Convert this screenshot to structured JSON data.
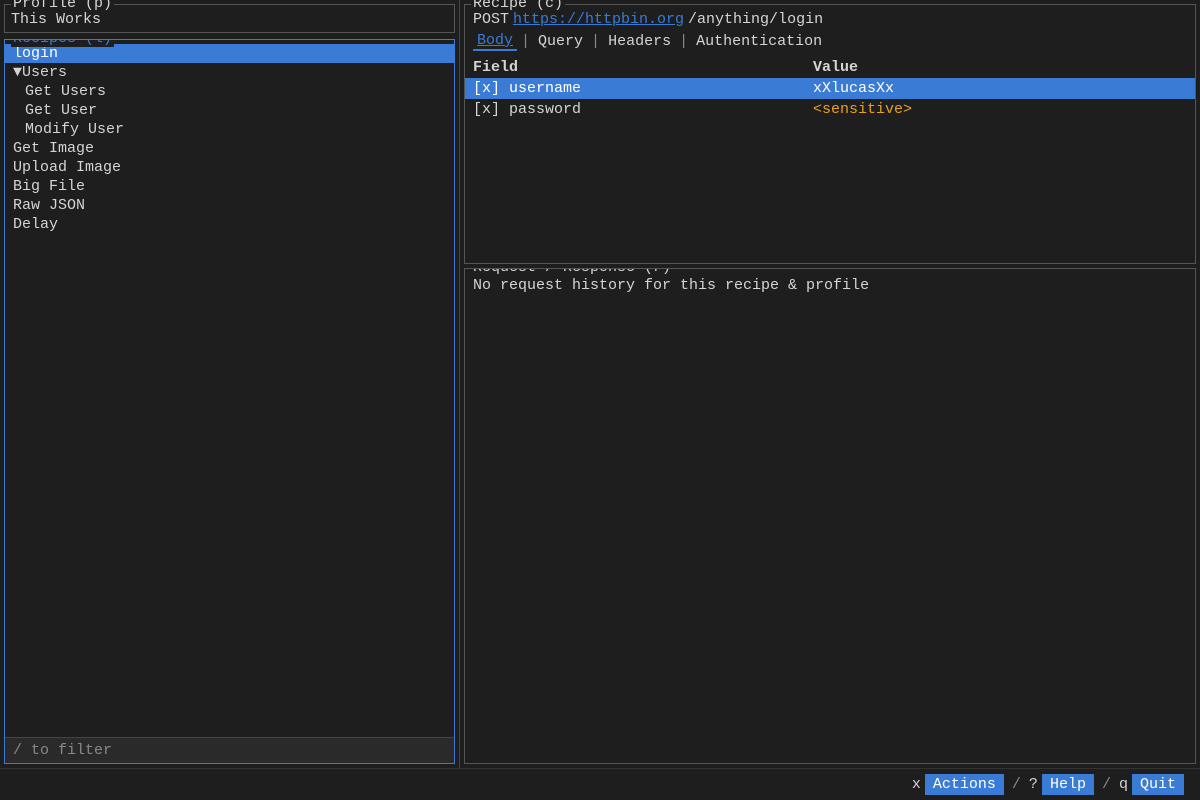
{
  "profile": {
    "section_title": "Profile (p)",
    "name": "This Works"
  },
  "recipes": {
    "section_title": "Recipes (l)",
    "items": [
      {
        "id": "login",
        "label": "login",
        "indent": 0,
        "selected": true
      },
      {
        "id": "users",
        "label": "▼Users",
        "indent": 0,
        "selected": false
      },
      {
        "id": "get-users",
        "label": "Get Users",
        "indent": 1,
        "selected": false
      },
      {
        "id": "get-user",
        "label": "Get User",
        "indent": 1,
        "selected": false
      },
      {
        "id": "modify-user",
        "label": "Modify User",
        "indent": 1,
        "selected": false
      },
      {
        "id": "get-image",
        "label": "Get Image",
        "indent": 0,
        "selected": false
      },
      {
        "id": "upload-image",
        "label": "Upload Image",
        "indent": 0,
        "selected": false
      },
      {
        "id": "big-file",
        "label": "Big File",
        "indent": 0,
        "selected": false
      },
      {
        "id": "raw-json",
        "label": "Raw JSON",
        "indent": 0,
        "selected": false
      },
      {
        "id": "delay",
        "label": "Delay",
        "indent": 0,
        "selected": false
      }
    ],
    "filter_placeholder": "/ to filter"
  },
  "recipe_detail": {
    "section_title": "Recipe (c)",
    "method": "POST",
    "url_base": "https://httpbin.org",
    "url_path": "/anything/login",
    "tabs": [
      {
        "id": "body",
        "label": "Body",
        "active": true
      },
      {
        "id": "query",
        "label": "Query",
        "active": false
      },
      {
        "id": "headers",
        "label": "Headers",
        "active": false
      },
      {
        "id": "authentication",
        "label": "Authentication",
        "active": false
      }
    ],
    "table": {
      "headers": {
        "field": "Field",
        "value": "Value"
      },
      "rows": [
        {
          "enabled": "[x]",
          "field": "username",
          "value": "xXlucasXx",
          "sensitive": false,
          "selected": true
        },
        {
          "enabled": "[x]",
          "field": "password",
          "value": "<sensitive>",
          "sensitive": true,
          "selected": false
        }
      ]
    }
  },
  "request_response": {
    "section_title": "Request / Response (r)",
    "empty_message": "No request history for this recipe & profile"
  },
  "bottom_bar": {
    "actions_key": "x",
    "actions_label": "Actions",
    "help_key": "?",
    "help_label": "Help",
    "quit_key": "q",
    "quit_label": "Quit",
    "separator": "/"
  }
}
